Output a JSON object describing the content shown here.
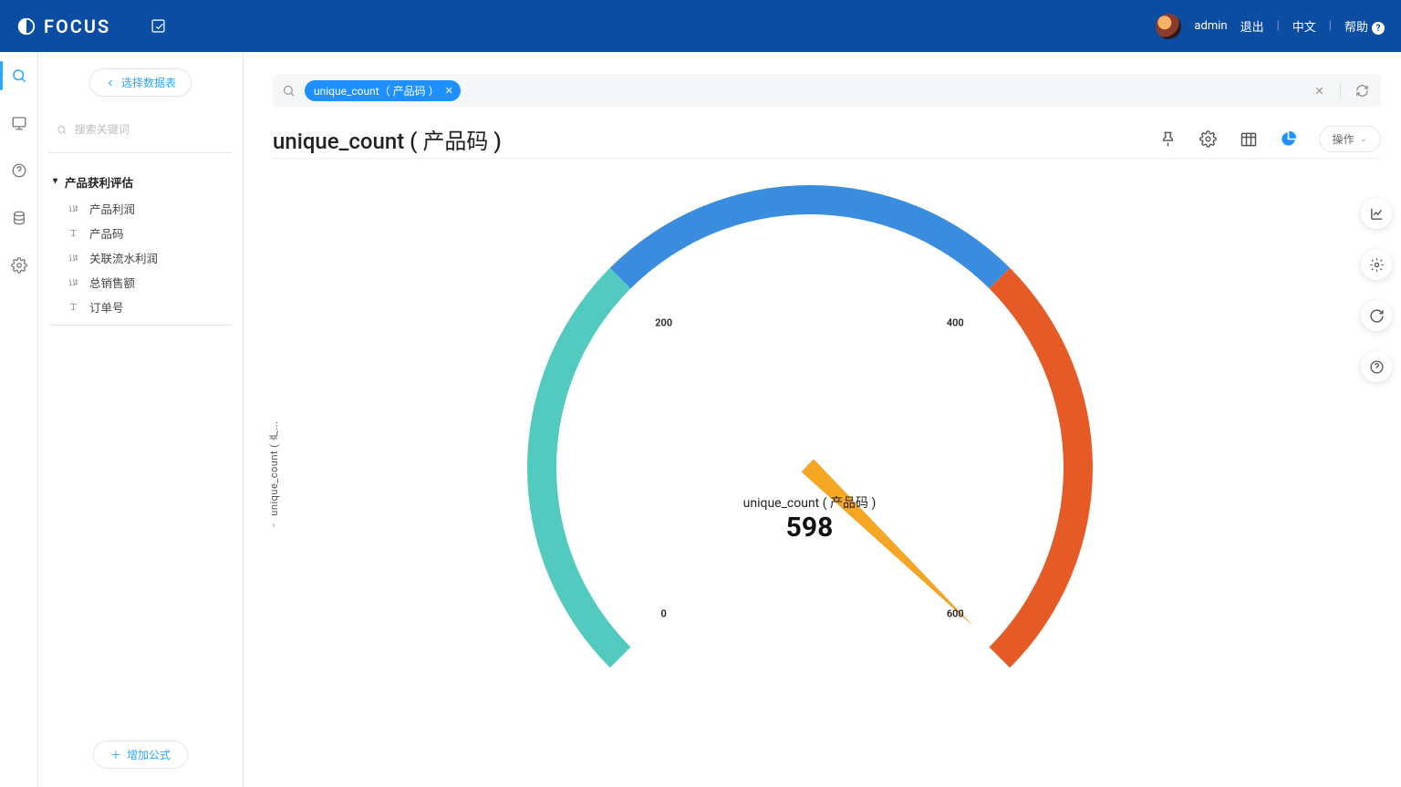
{
  "header": {
    "brand": "FOCUS",
    "user": "admin",
    "logout": "退出",
    "lang": "中文",
    "help": "帮助"
  },
  "sidebar": {
    "select_table_btn": "选择数据表",
    "search_placeholder": "搜索关键词",
    "group_title": "产品获利评估",
    "fields": [
      {
        "icon": "num",
        "label": "产品利润"
      },
      {
        "icon": "txt",
        "label": "产品码"
      },
      {
        "icon": "num",
        "label": "关联流水利润"
      },
      {
        "icon": "num",
        "label": "总销售额"
      },
      {
        "icon": "txt",
        "label": "订单号"
      }
    ],
    "add_formula": "增加公式"
  },
  "query": {
    "chip": "unique_count（ 产品码 ）"
  },
  "title": "unique_count ( 产品码 )",
  "ops_btn": "操作",
  "y_axis_label": "unique_count ( 产...",
  "gauge": {
    "label": "unique_count ( 产品码 )",
    "value_text": "598"
  },
  "chart_data": {
    "type": "gauge",
    "title": "unique_count ( 产品码 )",
    "value": 598,
    "min": 0,
    "max": 600,
    "ticks": [
      0,
      200,
      400,
      600
    ],
    "segments": [
      {
        "from": 0,
        "to": 200,
        "color": "#53cabf"
      },
      {
        "from": 200,
        "to": 400,
        "color": "#3a8dde"
      },
      {
        "from": 400,
        "to": 600,
        "color": "#e65a26"
      }
    ],
    "start_angle_deg": 225,
    "end_angle_deg": -45
  }
}
